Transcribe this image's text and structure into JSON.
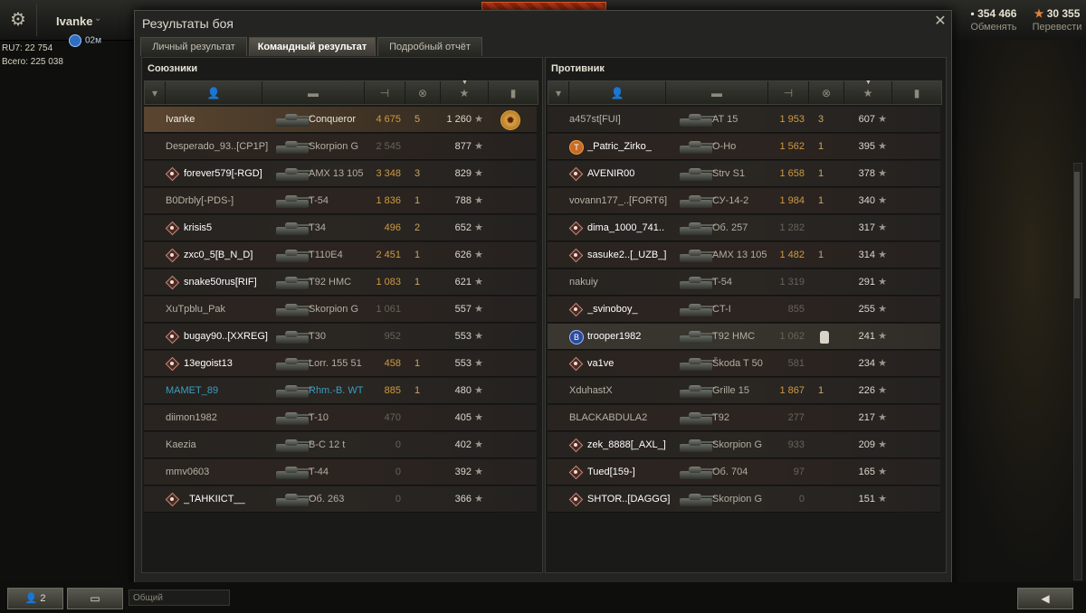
{
  "top": {
    "player": "Ivanke",
    "timer": "02м",
    "stat1": "RU7: 22 754",
    "stat2": "Всего: 225 038",
    "currency1": {
      "value": "354 466",
      "label": "Обменять"
    },
    "currency2": {
      "value": "30 355",
      "label": "Перевести"
    }
  },
  "dialog": {
    "title": "Результаты боя",
    "tabs": [
      "Личный результат",
      "Командный результат",
      "Подробный отчёт"
    ],
    "active_tab": "Командный результат"
  },
  "allies": {
    "title": "Союзники",
    "rows": [
      {
        "name": "Ivanke",
        "vehicle": "Conqueror",
        "damage": "4 675",
        "kills": "5",
        "xp": "1 260",
        "self": true
      },
      {
        "name": "Desperado_93..[CP1P]",
        "vehicle": "Skorpion G",
        "damage": "2 545",
        "kills": "",
        "xp": "877"
      },
      {
        "name": "forever579[-RGD]",
        "vehicle": "AMX 13 105",
        "damage": "3 348",
        "kills": "3",
        "xp": "829",
        "badge": "d"
      },
      {
        "name": "B0Drbly[-PDS-]",
        "vehicle": "T-54",
        "damage": "1 836",
        "kills": "1",
        "xp": "788"
      },
      {
        "name": "krisis5",
        "vehicle": "T34",
        "damage": "496",
        "kills": "2",
        "xp": "652",
        "badge": "d"
      },
      {
        "name": "zxc0_5[B_N_D]",
        "vehicle": "T110E4",
        "damage": "2 451",
        "kills": "1",
        "xp": "626",
        "badge": "d"
      },
      {
        "name": "snake50rus[RIF]",
        "vehicle": "T92 HMC",
        "damage": "1 083",
        "kills": "1",
        "xp": "621",
        "badge": "d"
      },
      {
        "name": "XuTpblu_Pak",
        "vehicle": "Skorpion G",
        "damage": "1 061",
        "kills": "",
        "xp": "557"
      },
      {
        "name": "bugay90..[XXREG]",
        "vehicle": "T30",
        "damage": "952",
        "kills": "",
        "xp": "553",
        "badge": "d"
      },
      {
        "name": "13egoist13",
        "vehicle": "Lorr. 155 51",
        "damage": "458",
        "kills": "1",
        "xp": "553",
        "badge": "d"
      },
      {
        "name": "MAMET_89",
        "vehicle": "Rhm.-B. WT",
        "damage": "885",
        "kills": "1",
        "xp": "480",
        "blue": true
      },
      {
        "name": "diimon1982",
        "vehicle": "T-10",
        "damage": "470",
        "kills": "",
        "xp": "405"
      },
      {
        "name": "Kaezia",
        "vehicle": "B-C 12 t",
        "damage": "0",
        "kills": "",
        "xp": "402"
      },
      {
        "name": "mmv0603",
        "vehicle": "T-44",
        "damage": "0",
        "kills": "",
        "xp": "392"
      },
      {
        "name": "_TAHKIICT__",
        "vehicle": "Об. 263",
        "damage": "0",
        "kills": "",
        "xp": "366",
        "badge": "d"
      }
    ]
  },
  "enemies": {
    "title": "Противник",
    "rows": [
      {
        "name": "a457st[FUI]",
        "vehicle": "AT 15",
        "damage": "1 953",
        "kills": "3",
        "xp": "607"
      },
      {
        "name": "_Patric_Zirko_",
        "vehicle": "O-Ho",
        "damage": "1 562",
        "kills": "1",
        "xp": "395",
        "badge": "t"
      },
      {
        "name": "AVENIR00",
        "vehicle": "Strv S1",
        "damage": "1 658",
        "kills": "1",
        "xp": "378",
        "badge": "d"
      },
      {
        "name": "vovann177_..[FORT6]",
        "vehicle": "СУ-14-2",
        "damage": "1 984",
        "kills": "1",
        "xp": "340"
      },
      {
        "name": "dima_1000_741..",
        "vehicle": "Об. 257",
        "damage": "1 282",
        "kills": "",
        "xp": "317",
        "badge": "d"
      },
      {
        "name": "sasuke2..[_UZB_]",
        "vehicle": "AMX 13 105",
        "damage": "1 482",
        "kills": "1",
        "xp": "314",
        "badge": "d"
      },
      {
        "name": "nakuiy",
        "vehicle": "T-54",
        "damage": "1 319",
        "kills": "",
        "xp": "291"
      },
      {
        "name": "_svinoboy_",
        "vehicle": "CT-I",
        "damage": "855",
        "kills": "",
        "xp": "255",
        "badge": "d"
      },
      {
        "name": "trooper1982",
        "vehicle": "T92 HMC",
        "damage": "1 062",
        "kills": "",
        "xp": "241",
        "badge": "b",
        "hl": true
      },
      {
        "name": "va1ve",
        "vehicle": "Škoda T 50",
        "damage": "581",
        "kills": "",
        "xp": "234",
        "badge": "d"
      },
      {
        "name": "XduhastX",
        "vehicle": "Grille 15",
        "damage": "1 867",
        "kills": "1",
        "xp": "226"
      },
      {
        "name": "BLACKABDULA2",
        "vehicle": "T92",
        "damage": "277",
        "kills": "",
        "xp": "217"
      },
      {
        "name": "zek_8888[_AXL_]",
        "vehicle": "Skorpion G",
        "damage": "933",
        "kills": "",
        "xp": "209",
        "badge": "d"
      },
      {
        "name": "Tued[159-]",
        "vehicle": "Об. 704",
        "damage": "97",
        "kills": "",
        "xp": "165",
        "badge": "d"
      },
      {
        "name": "SHTOR..[DAGGG]",
        "vehicle": "Skorpion G",
        "damage": "0",
        "kills": "",
        "xp": "151",
        "badge": "d"
      }
    ]
  },
  "bottom": {
    "friends": "2",
    "chat_placeholder": "Общий"
  }
}
